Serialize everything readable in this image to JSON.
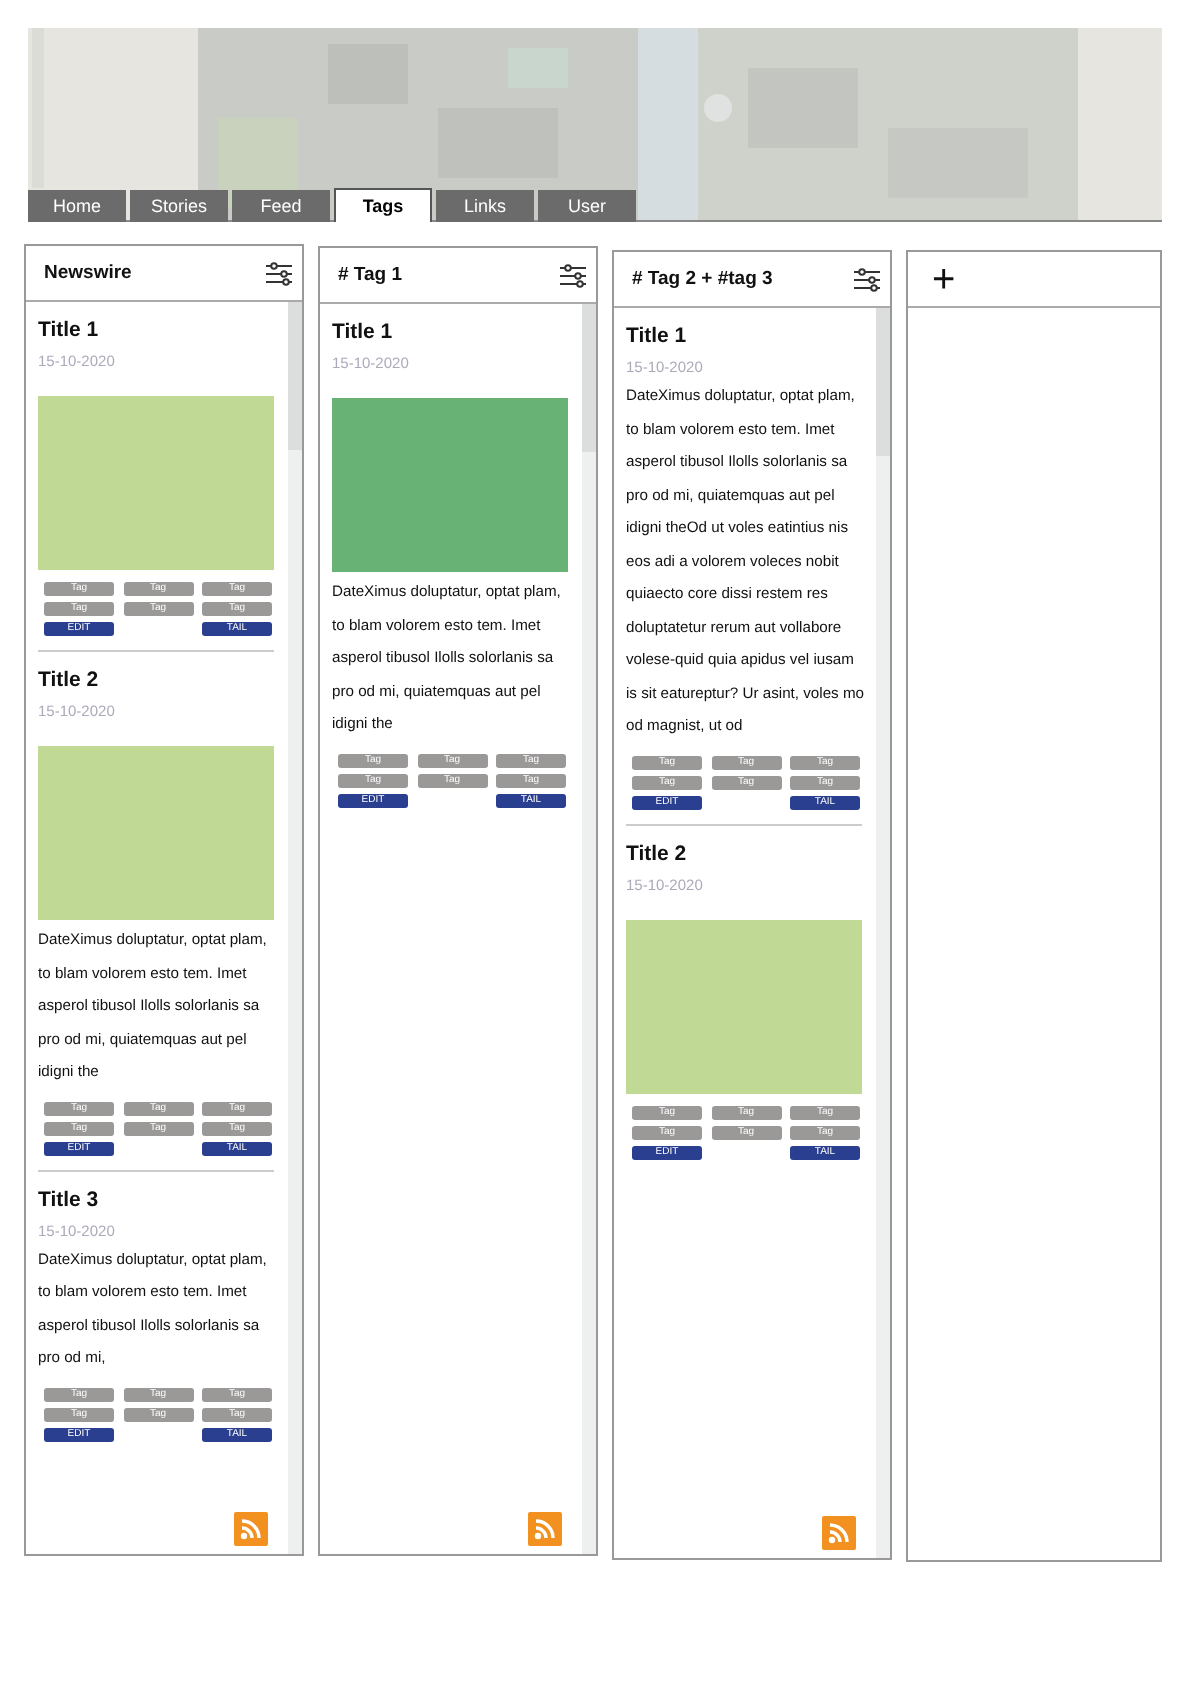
{
  "tabs": [
    {
      "label": "Home",
      "selected": false
    },
    {
      "label": "Stories",
      "selected": false
    },
    {
      "label": "Feed",
      "selected": false
    },
    {
      "label": "Tags",
      "selected": true
    },
    {
      "label": "Links",
      "selected": false
    },
    {
      "label": "User",
      "selected": false
    }
  ],
  "columns": [
    {
      "kind": "feed",
      "title": "Newswire",
      "stories": [
        {
          "title": "Title 1",
          "date": "15-10-2020",
          "image": {
            "color": "#c0da96"
          },
          "tags": [
            "Tag",
            "Tag",
            "Tag",
            "Tag",
            "Tag",
            "Tag"
          ],
          "actions": [
            "EDIT",
            "TAIL"
          ]
        },
        {
          "title": "Title 2",
          "date": "15-10-2020",
          "image": {
            "color": "#c0da96"
          },
          "body": "DateXimus doluptatur, optat plam, to blam volorem esto tem. Imet asperol tibusol Ilolls solorlanis sa pro od mi, quiatemquas aut pel idigni the",
          "tags": [
            "Tag",
            "Tag",
            "Tag",
            "Tag",
            "Tag",
            "Tag"
          ],
          "actions": [
            "EDIT",
            "TAIL"
          ]
        },
        {
          "title": "Title 3",
          "date": "15-10-2020",
          "body": "DateXimus doluptatur, optat plam, to blam volorem esto tem. Imet asperol tibusol Ilolls solorlanis sa pro od mi,",
          "tags": [
            "Tag",
            "Tag",
            "Tag",
            "Tag",
            "Tag",
            "Tag"
          ],
          "actions": [
            "EDIT",
            "TAIL"
          ]
        }
      ]
    },
    {
      "kind": "feed",
      "title": "# Tag 1",
      "stories": [
        {
          "title": "Title 1",
          "date": "15-10-2020",
          "image": {
            "color": "#69b276"
          },
          "body": "DateXimus doluptatur, optat plam, to blam volorem esto tem. Imet asperol tibusol Ilolls solorlanis sa pro od mi, quiatemquas aut pel idigni the",
          "tags": [
            "Tag",
            "Tag",
            "Tag",
            "Tag",
            "Tag",
            "Tag"
          ],
          "actions": [
            "EDIT",
            "TAIL"
          ]
        }
      ]
    },
    {
      "kind": "feed",
      "title": "# Tag 2 + #tag 3",
      "stories": [
        {
          "title": "Title 1",
          "date": "15-10-2020",
          "body": "DateXimus doluptatur, optat plam, to blam volorem esto tem. Imet asperol tibusol Ilolls solorlanis sa pro od mi, quiatemquas aut pel idigni theOd ut voles eatintius nis eos adi a volorem voleces nobit quiaecto core dissi restem res doluptatetur rerum aut vollabore volese-quid quia apidus vel iusam is sit eatureptur? Ur asint, voles mo od magnist, ut od",
          "tags": [
            "Tag",
            "Tag",
            "Tag",
            "Tag",
            "Tag",
            "Tag"
          ],
          "actions": [
            "EDIT",
            "TAIL"
          ]
        },
        {
          "title": "Title 2",
          "date": "15-10-2020",
          "image": {
            "color": "#c0da96"
          },
          "tags": [
            "Tag",
            "Tag",
            "Tag",
            "Tag",
            "Tag",
            "Tag"
          ],
          "actions": [
            "EDIT",
            "TAIL"
          ]
        }
      ]
    },
    {
      "kind": "add",
      "label": "+"
    }
  ]
}
